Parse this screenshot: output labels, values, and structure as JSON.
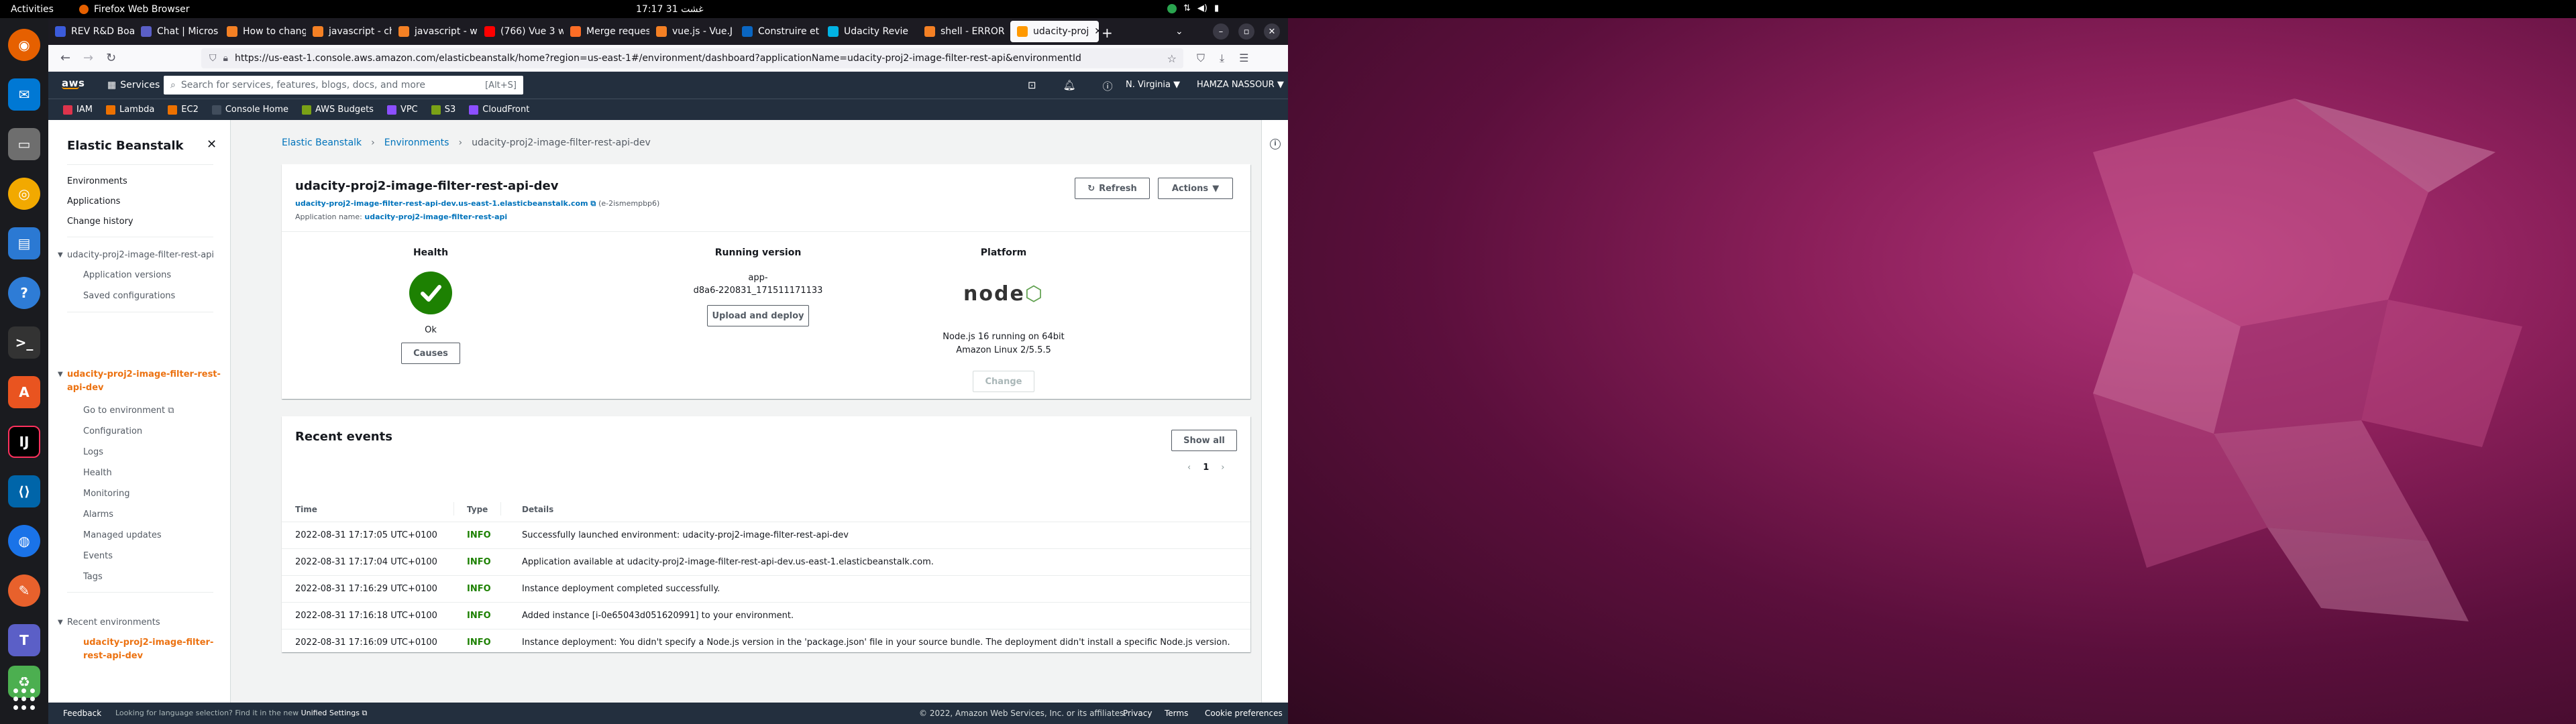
{
  "system": {
    "activities": "Activities",
    "app_name": "Firefox Web Browser",
    "clock": "17:17  31 غشت"
  },
  "browser": {
    "tabs": [
      {
        "label": "REV R&D Boa",
        "color": "#3b5bdb"
      },
      {
        "label": "Chat | Micros",
        "color": "#5b5fc7"
      },
      {
        "label": "How to chang",
        "color": "#f48024"
      },
      {
        "label": "javascript - ch",
        "color": "#f48024"
      },
      {
        "label": "javascript - wh",
        "color": "#f48024"
      },
      {
        "label": "(766) Vue 3 w",
        "color": "#ff0000"
      },
      {
        "label": "Merge reques",
        "color": "#fc6d26"
      },
      {
        "label": "vue.js - Vue.J",
        "color": "#f48024"
      },
      {
        "label": "Construire et",
        "color": "#0a66c2"
      },
      {
        "label": "Udacity Revie",
        "color": "#02b3e4"
      },
      {
        "label": "shell - ERROR",
        "color": "#f48024"
      },
      {
        "label": "udacity-proj",
        "color": "#ff9900"
      }
    ],
    "url": "https://us-east-1.console.aws.amazon.com/elasticbeanstalk/home?region=us-east-1#/environment/dashboard?applicationName=udacity-proj2-image-filter-rest-api&environmentId",
    "url_domain": "amazon.com"
  },
  "aws": {
    "logo": "aws",
    "services": "Services",
    "search_placeholder": "Search for services, features, blogs, docs, and more",
    "search_hint": "[Alt+S]",
    "region": "N. Virginia ▼",
    "user": "HAMZA NASSOUR ▼",
    "favorites": [
      {
        "label": "IAM",
        "color": "#dd344c"
      },
      {
        "label": "Lambda",
        "color": "#ed7100"
      },
      {
        "label": "EC2",
        "color": "#ed7100"
      },
      {
        "label": "Console Home",
        "color": "#232f3e"
      },
      {
        "label": "AWS Budgets",
        "color": "#7aa116"
      },
      {
        "label": "VPC",
        "color": "#8c4fff"
      },
      {
        "label": "S3",
        "color": "#7aa116"
      },
      {
        "label": "CloudFront",
        "color": "#8c4fff"
      }
    ]
  },
  "sidebar": {
    "title": "Elastic Beanstalk",
    "links": [
      "Environments",
      "Applications",
      "Change history"
    ],
    "app_name": "udacity-proj2-image-filter-rest-api",
    "app_items": [
      "Application versions",
      "Saved configurations"
    ],
    "env_name_line1": "udacity-proj2-image-filter-rest-",
    "env_name_line2": "api-dev",
    "env_items": [
      "Go to environment",
      "Configuration",
      "Logs",
      "Health",
      "Monitoring",
      "Alarms",
      "Managed updates",
      "Events",
      "Tags"
    ],
    "recent_label": "Recent environments",
    "recent_line1": "udacity-proj2-image-filter-",
    "recent_line2": "rest-api-dev"
  },
  "breadcrumb": {
    "items": [
      "Elastic Beanstalk",
      "Environments"
    ],
    "current": "udacity-proj2-image-filter-rest-api-dev"
  },
  "environment": {
    "name": "udacity-proj2-image-filter-rest-api-dev",
    "url": "udacity-proj2-image-filter-rest-api-dev.us-east-1.elasticbeanstalk.com",
    "id": "(e-2ismempbp6)",
    "app_label": "Application name:",
    "app_name": "udacity-proj2-image-filter-rest-api",
    "refresh": "Refresh",
    "actions": "Actions",
    "health_label": "Health",
    "health_status": "Ok",
    "causes": "Causes",
    "version_label": "Running version",
    "version_line1": "app-",
    "version_line2": "d8a6-220831_171511171133",
    "upload": "Upload and deploy",
    "platform_label": "Platform",
    "platform_logo": "node",
    "platform_line1": "Node.js 16 running on 64bit",
    "platform_line2": "Amazon Linux 2/5.5.5",
    "change": "Change"
  },
  "events": {
    "title": "Recent events",
    "show_all": "Show all",
    "page": "1",
    "columns": [
      "Time",
      "Type",
      "Details"
    ],
    "rows": [
      {
        "time": "2022-08-31 17:17:05 UTC+0100",
        "type": "INFO",
        "details": "Successfully launched environment: udacity-proj2-image-filter-rest-api-dev"
      },
      {
        "time": "2022-08-31 17:17:04 UTC+0100",
        "type": "INFO",
        "details": "Application available at udacity-proj2-image-filter-rest-api-dev.us-east-1.elasticbeanstalk.com."
      },
      {
        "time": "2022-08-31 17:16:29 UTC+0100",
        "type": "INFO",
        "details": "Instance deployment completed successfully."
      },
      {
        "time": "2022-08-31 17:16:18 UTC+0100",
        "type": "INFO",
        "details": "Added instance [i-0e65043d051620991] to your environment."
      },
      {
        "time": "2022-08-31 17:16:09 UTC+0100",
        "type": "INFO",
        "details": "Instance deployment: You didn't specify a Node.js version in the 'package.json' file in your source bundle. The deployment didn't install a specific Node.js version."
      }
    ]
  },
  "footer": {
    "feedback": "Feedback",
    "language": "Looking for language selection? Find it in the new",
    "unified": "Unified Settings",
    "copyright": "© 2022, Amazon Web Services, Inc. or its affiliates.",
    "privacy": "Privacy",
    "terms": "Terms",
    "cookies": "Cookie preferences"
  }
}
